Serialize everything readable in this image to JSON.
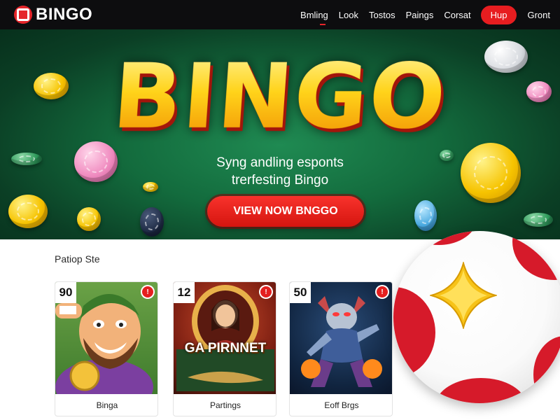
{
  "header": {
    "brand": "BINGO",
    "nav": [
      "Bmling",
      "Look",
      "Tostos",
      "Paings",
      "Corsat"
    ],
    "nav_pill": "Hup",
    "nav_last": "Gront"
  },
  "hero": {
    "title": "BINGO",
    "subtitle_line1": "Syng andling esponts",
    "subtitle_line2": "trerfesting Bingo",
    "cta": "VIEW NOW BNGGO"
  },
  "section": {
    "title": "Patiop Ste",
    "cards": [
      {
        "number": "90",
        "badge": "!",
        "label": "Binga"
      },
      {
        "number": "12",
        "badge": "!",
        "label": "Partings",
        "art_text": "GA PIRNNET"
      },
      {
        "number": "50",
        "badge": "!",
        "label": "Eoff Brgs"
      }
    ]
  },
  "colors": {
    "accent_red": "#e71d20",
    "nav_bg": "#0d0d0f",
    "hero_green": "#136b3d",
    "title_gold": "#ffd21c"
  }
}
